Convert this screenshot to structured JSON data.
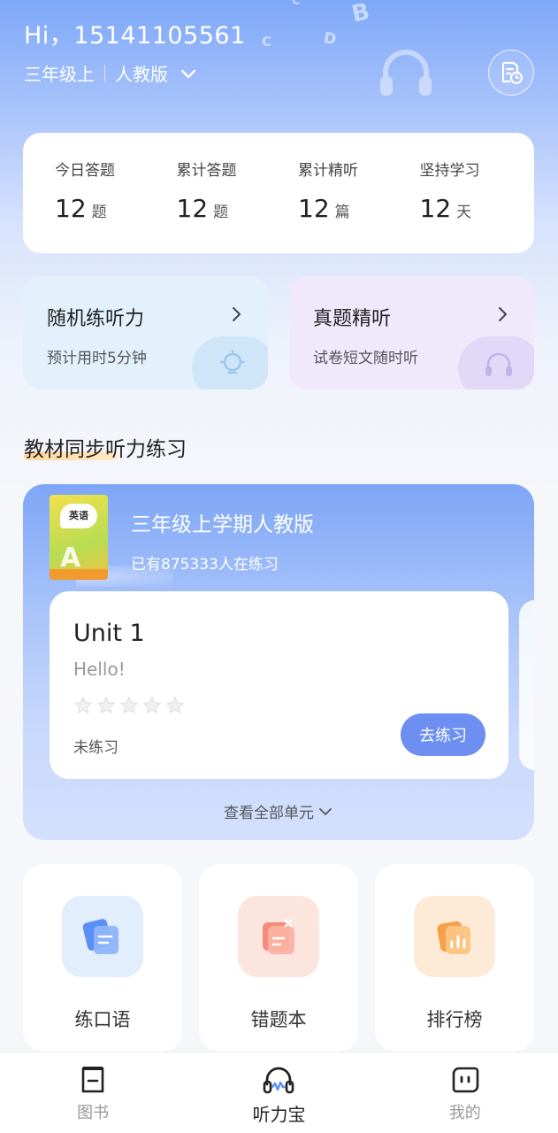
{
  "header": {
    "greeting": "Hi，15141105561",
    "grade": "三年级上",
    "edition": "人教版",
    "deco_letters": [
      "B",
      "C",
      "D",
      "C"
    ]
  },
  "stats": [
    {
      "label": "今日答题",
      "value": "12",
      "unit": "题"
    },
    {
      "label": "累计答题",
      "value": "12",
      "unit": "题"
    },
    {
      "label": "累计精听",
      "value": "12",
      "unit": "篇"
    },
    {
      "label": "坚持学习",
      "value": "12",
      "unit": "天"
    }
  ],
  "features": {
    "random": {
      "title": "随机练听力",
      "subtitle": "预计用时5分钟"
    },
    "exam": {
      "title": "真题精听",
      "subtitle": "试卷短文随时听"
    }
  },
  "section": {
    "title": "教材同步听力练习"
  },
  "textbook": {
    "cover_badge": "英语",
    "title": "三年级上学期人教版",
    "learners": "已有875333人在练习",
    "view_all": "查看全部单元"
  },
  "unit": {
    "title": "Unit 1",
    "subtitle": "Hello!",
    "stars_filled": 0,
    "stars_total": 5,
    "status": "未练习",
    "button": "去练习"
  },
  "tools": [
    {
      "label": "练口语",
      "icon": "speaking-icon"
    },
    {
      "label": "错题本",
      "icon": "mistake-book-icon"
    },
    {
      "label": "排行榜",
      "icon": "leaderboard-icon"
    }
  ],
  "tabbar": [
    {
      "label": "图书",
      "icon": "book-icon",
      "active": false
    },
    {
      "label": "听力宝",
      "icon": "headphones-icon",
      "active": true
    },
    {
      "label": "我的",
      "icon": "profile-face-icon",
      "active": false
    }
  ],
  "colors": {
    "primary": "#6c8ff1",
    "hero_top": "#7ea8f8",
    "random_card": "#e3f1fc",
    "exam_card": "#efe9fb",
    "underline": "#ffd79a"
  }
}
